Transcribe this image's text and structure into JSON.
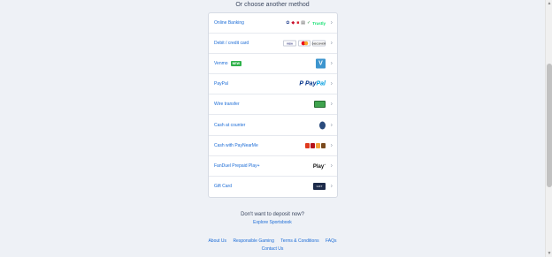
{
  "heading": "Or choose another method",
  "methods": [
    {
      "label": "Online Banking",
      "logos": "trustly"
    },
    {
      "label": "Debit / credit card",
      "cards": [
        "VISA",
        "MC",
        "DISCOVER"
      ]
    },
    {
      "label": "Venmo",
      "badge": "NEW",
      "logo": "V"
    },
    {
      "label": "PayPal",
      "logo_a": "Pay",
      "logo_b": "Pal"
    },
    {
      "label": "Wire transfer"
    },
    {
      "label": "Cash at counter"
    },
    {
      "label": "Cash with PayNearMe"
    },
    {
      "label": "FanDuel Prepaid Play+",
      "logo": "Play"
    },
    {
      "label": "Gift Card",
      "logo": "GIFT"
    }
  ],
  "trustly_text": "Trustly",
  "no_deposit": "Don't want to deposit now?",
  "explore": "Explore Sportsbook",
  "footer": {
    "about": "About Us",
    "responsible": "Responsible Gaming",
    "terms": "Terms & Conditions",
    "faqs": "FAQs",
    "contact": "Contact Us"
  },
  "colors": {
    "background": "#eef1f6",
    "link": "#1a6bd6",
    "badge_green": "#2fb24a",
    "paypal_dark": "#003087",
    "paypal_light": "#009cde",
    "venmo": "#3d95ce"
  }
}
